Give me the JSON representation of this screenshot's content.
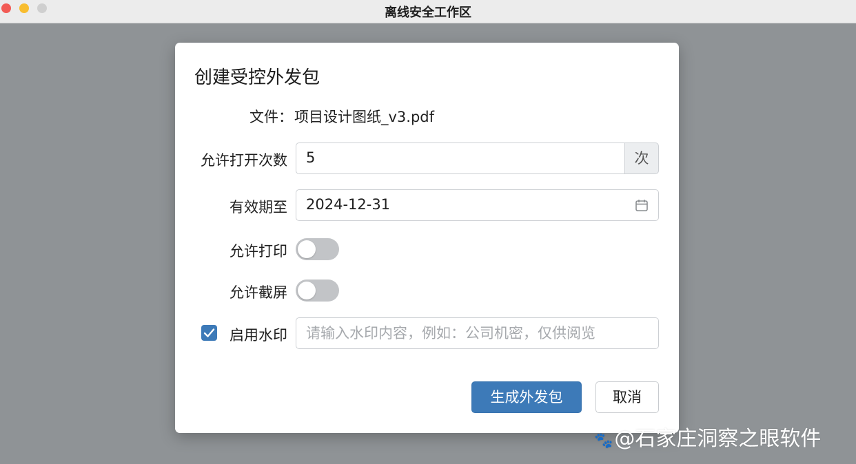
{
  "window": {
    "title": "离线安全工作区"
  },
  "dialog": {
    "title": "创建受控外发包",
    "file": {
      "label": "文件：",
      "name": "项目设计图纸_v3.pdf"
    },
    "open_count": {
      "label": "允许打开次数",
      "value": "5",
      "unit": "次"
    },
    "expiry": {
      "label": "有效期至",
      "value": "2024-12-31",
      "icon": "calendar-icon"
    },
    "allow_print": {
      "label": "允许打印",
      "enabled": false
    },
    "allow_screenshot": {
      "label": "允许截屏",
      "enabled": false
    },
    "watermark": {
      "label": "启用水印",
      "checked": true,
      "placeholder": "请输入水印内容，例如：公司机密，仅供阅览",
      "value": ""
    },
    "buttons": {
      "generate": "生成外发包",
      "cancel": "取消"
    }
  },
  "overlay": {
    "brand": "@石家庄洞察之眼软件"
  },
  "colors": {
    "accent": "#3d7ab8",
    "backdrop": "#8f9396",
    "toggle_off": "#c2c4c7"
  }
}
